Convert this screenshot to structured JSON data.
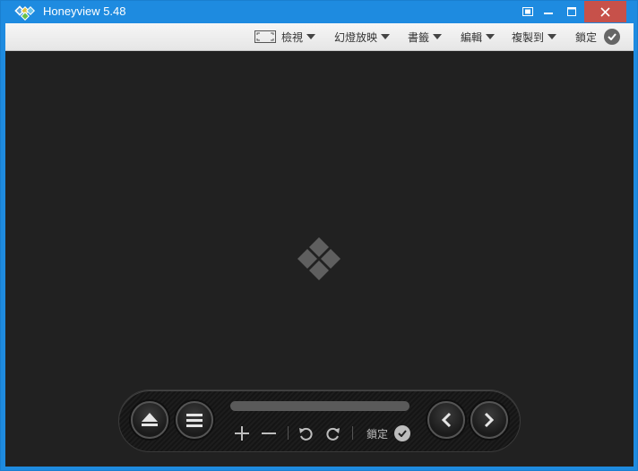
{
  "window": {
    "title": "Honeyview 5.48"
  },
  "toolbar": {
    "items": [
      {
        "label": "檢視",
        "icon": "fullscreen-frame-icon"
      },
      {
        "label": "幻燈放映"
      },
      {
        "label": "書籤"
      },
      {
        "label": "編輯"
      },
      {
        "label": "複製到"
      }
    ],
    "lock_label": "鎖定"
  },
  "controls": {
    "lock_label": "鎖定",
    "buttons": [
      "eject-icon",
      "menu-icon",
      "zoom-in-icon",
      "zoom-out-icon",
      "rotate-left-icon",
      "rotate-right-icon",
      "previous-icon",
      "next-icon"
    ]
  },
  "colors": {
    "titlebar": "#1e8be0",
    "close": "#c7514a",
    "viewer_bg": "#212121",
    "logo_gray": "#5f5f5f"
  }
}
